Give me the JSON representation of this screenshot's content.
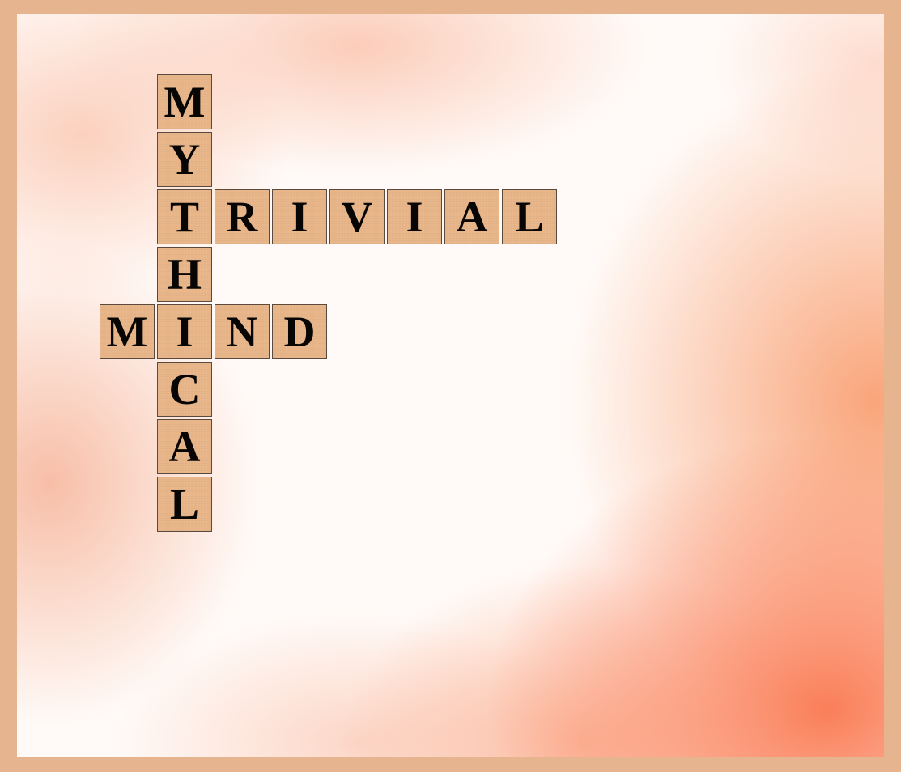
{
  "colors": {
    "frame": "#e6b48e",
    "tile": "#e8b589",
    "tile_border": "#5a4a3e",
    "letter": "#080604",
    "wash_accent": "#fa7850"
  },
  "words": {
    "vertical": {
      "word": "MYTHICAL",
      "letters": [
        "M",
        "Y",
        "T",
        "H",
        "I",
        "C",
        "A",
        "L"
      ]
    },
    "trivial": {
      "word": "TRIVIAL",
      "letters": [
        "R",
        "I",
        "V",
        "I",
        "A",
        "L"
      ]
    },
    "mind": {
      "word": "MIND",
      "letters": [
        "M",
        "N",
        "D"
      ]
    }
  }
}
